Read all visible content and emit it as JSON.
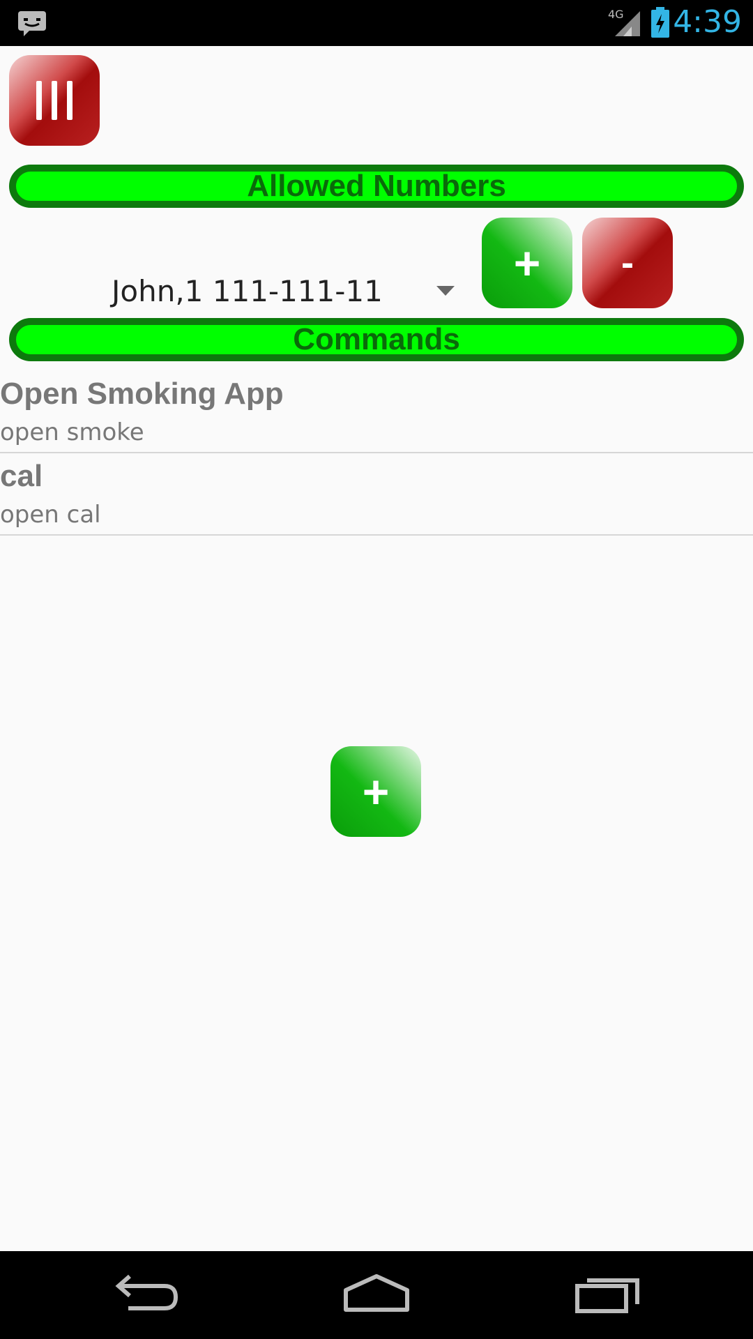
{
  "status_bar": {
    "time": "4:39",
    "network": "4G",
    "icons": [
      "message-icon",
      "signal-icon",
      "battery-charging-icon"
    ]
  },
  "menu_button": {
    "icon": "menu-icon"
  },
  "allowed_numbers": {
    "header": "Allowed Numbers",
    "selected_number": "John,1 111-111-11",
    "add_label": "+",
    "remove_label": "-"
  },
  "commands": {
    "header": "Commands",
    "items": [
      {
        "title": "Open Smoking App",
        "command": "open smoke"
      },
      {
        "title": "cal",
        "command": "open cal"
      }
    ],
    "add_label": "+"
  },
  "nav_bar": {
    "icons": [
      "back-icon",
      "home-icon",
      "recent-apps-icon"
    ]
  },
  "colors": {
    "header_fill": "#00ff00",
    "header_border": "#0d7a0d",
    "accent_red": "#a30d0d",
    "accent_green": "#13b813",
    "clock": "#33b5e5"
  }
}
